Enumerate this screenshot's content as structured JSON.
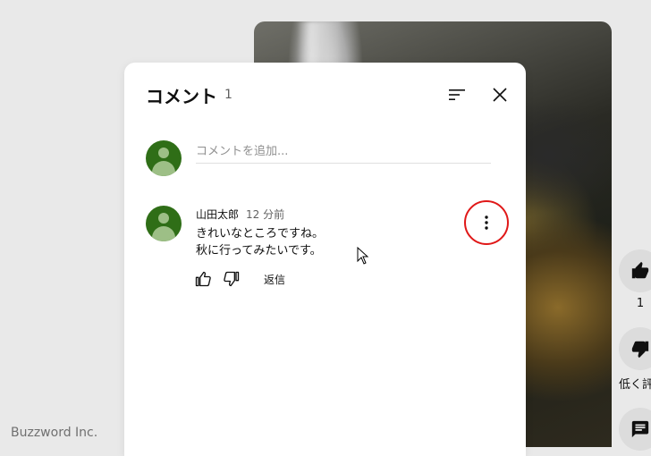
{
  "panel": {
    "title": "コメント",
    "count": "1",
    "input_placeholder": "コメントを追加..."
  },
  "comment": {
    "author": "山田太郎",
    "time": "12 分前",
    "lines": [
      "きれいなところですね。",
      "秋に行ってみたいです。"
    ],
    "reply_label": "返信"
  },
  "rail": {
    "like_count": "1",
    "dislike_label": "低く評"
  },
  "watermark": "Buzzword Inc.",
  "colors": {
    "avatar": "#2f6e17",
    "highlight": "#e01818"
  },
  "icons": [
    "sort-icon",
    "close-icon",
    "thumb-up-icon",
    "thumb-down-icon",
    "more-vert-icon",
    "comment-icon"
  ]
}
